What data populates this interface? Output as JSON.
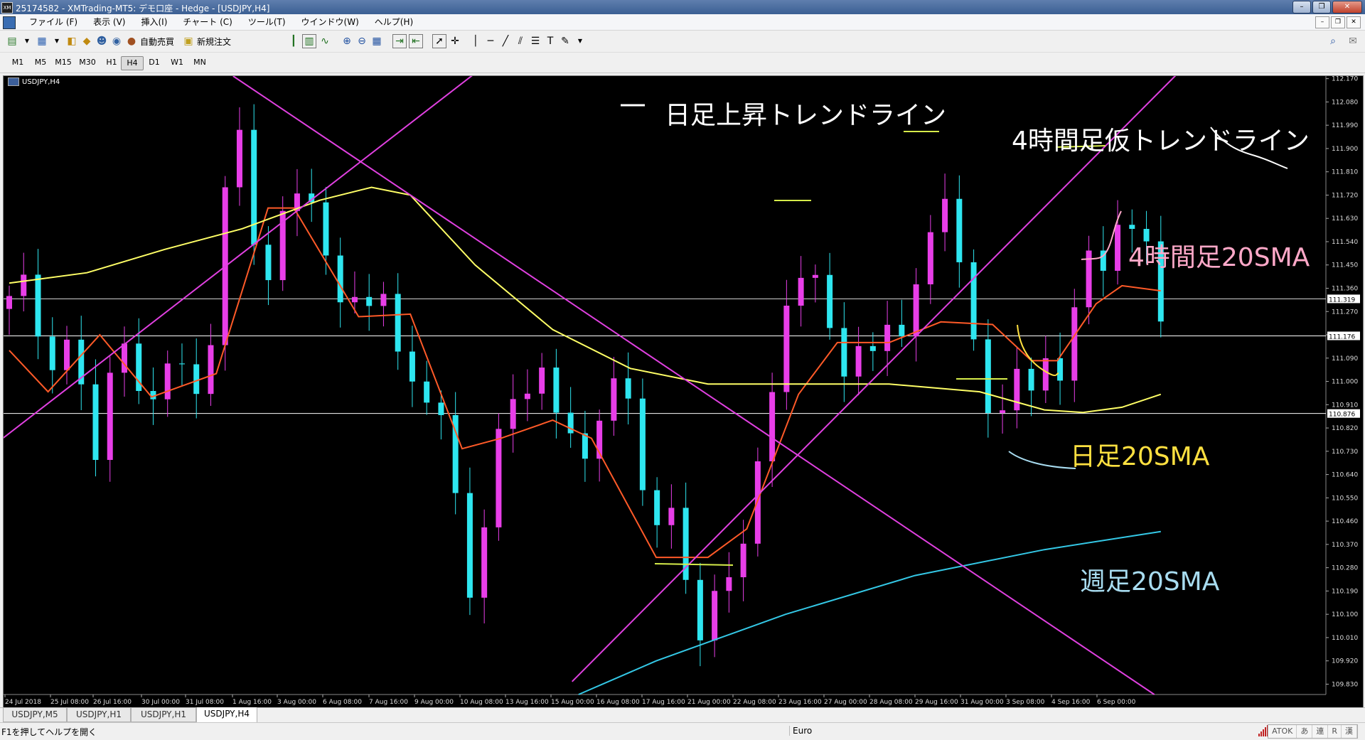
{
  "window": {
    "title": "25174582 - XMTrading-MT5: デモ口座 - Hedge - [USDJPY,H4]"
  },
  "menu": [
    "ファイル (F)",
    "表示 (V)",
    "挿入(I)",
    "チャート (C)",
    "ツール(T)",
    "ウインドウ(W)",
    "ヘルプ(H)"
  ],
  "toolbar": {
    "auto_trade": "自動売買",
    "new_order": "新規注文"
  },
  "timeframes": {
    "items": [
      "M1",
      "M5",
      "M15",
      "M30",
      "H1",
      "H4",
      "D1",
      "W1",
      "MN"
    ],
    "active": "H4"
  },
  "chart": {
    "symbol_label": "USDJPY,H4"
  },
  "chart_data": {
    "type": "candlestick",
    "symbol": "USDJPY",
    "timeframe": "H4",
    "y_ticks": [
      "112.170",
      "112.080",
      "111.990",
      "111.900",
      "111.810",
      "111.720",
      "111.630",
      "111.540",
      "111.450",
      "111.360",
      "111.270",
      "111.180",
      "111.090",
      "111.000",
      "110.910",
      "110.820",
      "110.730",
      "110.640",
      "110.550",
      "110.460",
      "110.370",
      "110.280",
      "110.190",
      "110.100",
      "110.010",
      "109.920",
      "109.830"
    ],
    "ylim": [
      109.79,
      112.18
    ],
    "x_ticks": [
      "24 Jul 2018",
      "25 Jul 08:00",
      "26 Jul 16:00",
      "30 Jul 00:00",
      "31 Jul 08:00",
      "1 Aug 16:00",
      "3 Aug 00:00",
      "6 Aug 08:00",
      "7 Aug 16:00",
      "9 Aug 00:00",
      "10 Aug 08:00",
      "13 Aug 16:00",
      "15 Aug 00:00",
      "16 Aug 08:00",
      "17 Aug 16:00",
      "21 Aug 00:00",
      "22 Aug 08:00",
      "23 Aug 16:00",
      "27 Aug 00:00",
      "28 Aug 08:00",
      "29 Aug 16:00",
      "31 Aug 00:00",
      "3 Sep 08:00",
      "4 Sep 16:00",
      "6 Sep 00:00"
    ],
    "close_anchors": [
      [
        0,
        111.3
      ],
      [
        1,
        111.36
      ],
      [
        2,
        111.22
      ],
      [
        3,
        111.1
      ],
      [
        4,
        111.15
      ],
      [
        5,
        111.18
      ],
      [
        6,
        110.78
      ],
      [
        7,
        110.68
      ],
      [
        8,
        111.13
      ],
      [
        9,
        111.08
      ],
      [
        10,
        110.95
      ],
      [
        11,
        110.99
      ],
      [
        12,
        111.12
      ],
      [
        13,
        111.05
      ],
      [
        14,
        110.97
      ],
      [
        15,
        110.9
      ],
      [
        16,
        111.35
      ],
      [
        17,
        111.88
      ],
      [
        18,
        111.95
      ],
      [
        19,
        111.55
      ],
      [
        20,
        111.45
      ],
      [
        21,
        111.62
      ],
      [
        22,
        111.66
      ],
      [
        23,
        111.74
      ],
      [
        24,
        111.65
      ],
      [
        25,
        111.3
      ],
      [
        26,
        111.24
      ],
      [
        27,
        111.4
      ],
      [
        28,
        111.36
      ],
      [
        29,
        111.33
      ],
      [
        30,
        111.05
      ],
      [
        31,
        111.0
      ],
      [
        32,
        110.95
      ],
      [
        33,
        110.92
      ],
      [
        34,
        110.72
      ],
      [
        35,
        110.4
      ],
      [
        36,
        110.12
      ],
      [
        37,
        110.6
      ],
      [
        38,
        110.78
      ],
      [
        39,
        110.9
      ],
      [
        40,
        110.98
      ],
      [
        41,
        111.1
      ],
      [
        42,
        110.85
      ],
      [
        43,
        110.88
      ],
      [
        44,
        110.78
      ],
      [
        45,
        110.72
      ],
      [
        46,
        110.85
      ],
      [
        47,
        110.98
      ],
      [
        48,
        110.95
      ],
      [
        49,
        110.6
      ],
      [
        50,
        110.42
      ],
      [
        51,
        110.55
      ],
      [
        52,
        110.38
      ],
      [
        53,
        110.05
      ],
      [
        54,
        109.88
      ],
      [
        55,
        110.33
      ],
      [
        56,
        110.18
      ],
      [
        57,
        110.52
      ],
      [
        58,
        110.73
      ],
      [
        59,
        110.95
      ],
      [
        60,
        111.32
      ],
      [
        61,
        111.42
      ],
      [
        62,
        111.38
      ],
      [
        63,
        111.25
      ],
      [
        64,
        111.05
      ],
      [
        65,
        111.1
      ],
      [
        66,
        111.22
      ],
      [
        67,
        111.05
      ],
      [
        68,
        111.25
      ],
      [
        69,
        111.2
      ],
      [
        70,
        111.32
      ],
      [
        71,
        111.45
      ],
      [
        72,
        111.78
      ],
      [
        73,
        111.66
      ],
      [
        74,
        111.35
      ],
      [
        75,
        110.98
      ],
      [
        76,
        110.78
      ],
      [
        77,
        110.95
      ],
      [
        78,
        111.05
      ],
      [
        79,
        110.9
      ],
      [
        80,
        111.1
      ],
      [
        81,
        111.05
      ],
      [
        82,
        111.2
      ],
      [
        83,
        111.52
      ],
      [
        84,
        111.38
      ],
      [
        85,
        111.46
      ],
      [
        86,
        111.7
      ],
      [
        87,
        111.5
      ],
      [
        88,
        111.52
      ],
      [
        89,
        111.3
      ]
    ],
    "moving_averages": [
      {
        "name": "4時間足20SMA",
        "color": "#ff5a28",
        "anchors": [
          [
            0,
            111.12
          ],
          [
            3,
            110.96
          ],
          [
            7,
            111.18
          ],
          [
            11,
            110.94
          ],
          [
            16,
            111.03
          ],
          [
            20,
            111.67
          ],
          [
            22,
            111.67
          ],
          [
            27,
            111.25
          ],
          [
            31,
            111.26
          ],
          [
            35,
            110.74
          ],
          [
            38,
            110.78
          ],
          [
            42,
            110.85
          ],
          [
            45,
            110.78
          ],
          [
            50,
            110.32
          ],
          [
            54,
            110.32
          ],
          [
            57,
            110.43
          ],
          [
            61,
            110.95
          ],
          [
            64,
            111.15
          ],
          [
            68,
            111.15
          ],
          [
            72,
            111.23
          ],
          [
            76,
            111.22
          ],
          [
            79,
            111.08
          ],
          [
            81,
            111.08
          ],
          [
            84,
            111.3
          ],
          [
            86,
            111.37
          ],
          [
            89,
            111.35
          ]
        ]
      },
      {
        "name": "日足20SMA",
        "color": "#ffff66",
        "anchors": [
          [
            0,
            111.38
          ],
          [
            6,
            111.42
          ],
          [
            12,
            111.51
          ],
          [
            18,
            111.59
          ],
          [
            24,
            111.7
          ],
          [
            28,
            111.75
          ],
          [
            31,
            111.72
          ],
          [
            36,
            111.45
          ],
          [
            42,
            111.2
          ],
          [
            48,
            111.05
          ],
          [
            54,
            110.99
          ],
          [
            60,
            110.99
          ],
          [
            68,
            110.99
          ],
          [
            75,
            110.96
          ],
          [
            80,
            110.89
          ],
          [
            83,
            110.88
          ],
          [
            86,
            110.9
          ],
          [
            89,
            110.95
          ]
        ]
      },
      {
        "name": "週足20SMA",
        "color": "#34c8e6",
        "anchors": [
          [
            44,
            109.79
          ],
          [
            50,
            109.92
          ],
          [
            60,
            110.1
          ],
          [
            70,
            110.25
          ],
          [
            80,
            110.35
          ],
          [
            89,
            110.42
          ]
        ]
      }
    ],
    "trendlines": [
      {
        "name": "日足上昇トレンドライン",
        "color": "#e040e0"
      },
      {
        "name": "downtrend",
        "color": "#e040e0"
      },
      {
        "name": "4時間足仮トレンドライン",
        "color": "#e040e0"
      }
    ],
    "horizontal_levels": [
      {
        "value": 111.319,
        "label": "111.319",
        "color": "#d8d8d8"
      },
      {
        "value": 111.176,
        "label": "111.176",
        "color": "#ffffff"
      },
      {
        "value": 110.876,
        "label": "110.876",
        "color": "#ffffff"
      }
    ],
    "annotations": [
      {
        "text": "日足上昇トレンドライン",
        "color": "#ffffff"
      },
      {
        "text": "4時間足仮トレンドライン",
        "color": "#ffffff"
      },
      {
        "text": "4時間足20SMA",
        "color": "#ffa8c8"
      },
      {
        "text": "日足20SMA",
        "color": "#ffe040"
      },
      {
        "text": "週足20SMA",
        "color": "#a8dcf0"
      }
    ],
    "bull_color": "#e83ee8",
    "bear_color": "#2ee6f0"
  },
  "tabs": {
    "items": [
      "USDJPY,M5",
      "USDJPY,H1",
      "USDJPY,H1",
      "USDJPY,H4"
    ],
    "active_index": 3
  },
  "status": {
    "help": "F1を押してヘルプを開く",
    "profile": "Euro",
    "ime": [
      "ATOK",
      "あ",
      "連",
      "R",
      "漢"
    ]
  }
}
